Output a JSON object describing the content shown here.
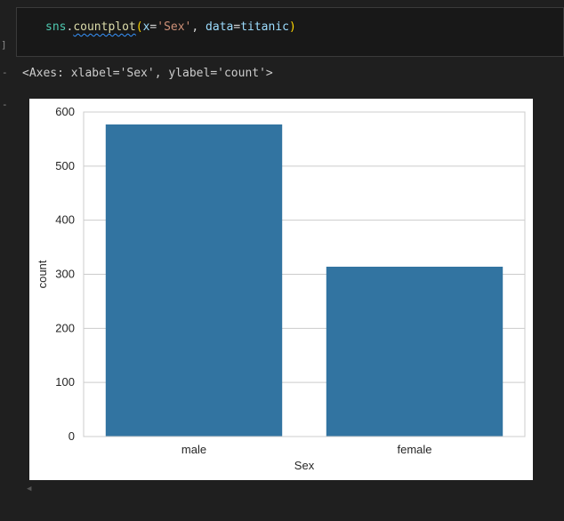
{
  "cell": {
    "code_tokens": {
      "module": "sns",
      "dot": ".",
      "function": "countplot",
      "open_paren": "(",
      "param_x": "x",
      "eq1": "=",
      "arg_x": "'Sex'",
      "comma": ", ",
      "param_data": "data",
      "eq2": "=",
      "arg_data": "titanic",
      "close_paren": ")"
    },
    "exec_bracket": "]",
    "output_marker": "-",
    "output_text": "<Axes: xlabel='Sex', ylabel='count'>"
  },
  "chart_data": {
    "type": "bar",
    "categories": [
      "male",
      "female"
    ],
    "values": [
      577,
      314
    ],
    "xlabel": "Sex",
    "ylabel": "count",
    "ylim": [
      0,
      600
    ],
    "yticks": [
      "0",
      "100",
      "200",
      "300",
      "400",
      "500",
      "600"
    ],
    "grid": "horizontal",
    "bar_color": "#3274a1",
    "grid_color": "#cccccc",
    "spine_color": "#cccccc"
  },
  "colors": {
    "background": "#1f1f1f",
    "cell_background": "#181818",
    "plot_background": "#ffffff"
  },
  "icons": {
    "scroll": "scroll-left-icon"
  }
}
